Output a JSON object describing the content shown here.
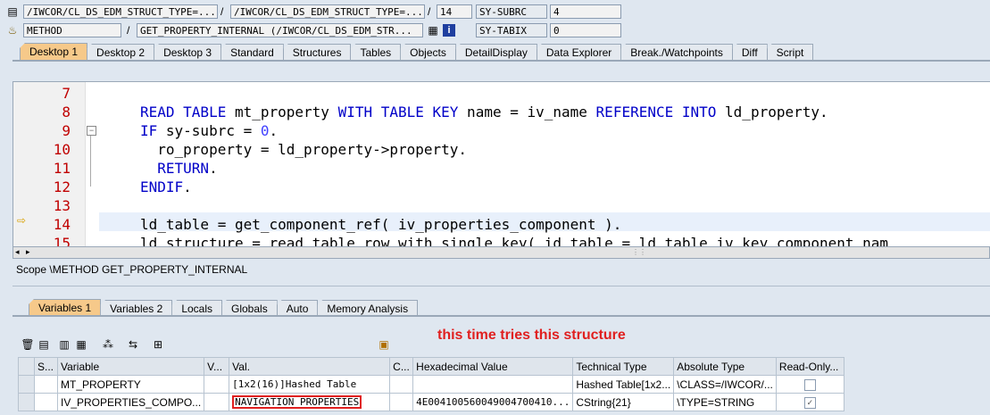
{
  "header": {
    "row1": {
      "f1": "/IWCOR/CL_DS_EDM_STRUCT_TYPE=...",
      "f2": "/IWCOR/CL_DS_EDM_STRUCT_TYPE=...",
      "line": "14",
      "sysname": "SY-SUBRC",
      "sysval": "4"
    },
    "row2": {
      "type": "METHOD",
      "method": "GET_PROPERTY_INTERNAL (/IWCOR/CL_DS_EDM_STR...",
      "sysname": "SY-TABIX",
      "sysval": "0"
    },
    "sep": "/"
  },
  "desktop_tabs": [
    "Desktop 1",
    "Desktop 2",
    "Desktop 3",
    "Standard",
    "Structures",
    "Tables",
    "Objects",
    "DetailDisplay",
    "Data Explorer",
    "Break./Watchpoints",
    "Diff",
    "Script"
  ],
  "editor": {
    "line_numbers": [
      "7",
      "8",
      "9",
      "10",
      "11",
      "12",
      "13",
      "14",
      "15"
    ],
    "lines": {
      "l8a": "READ TABLE",
      "l8b": " mt_property ",
      "l8c": "WITH TABLE KEY",
      "l8d": " name = iv_name ",
      "l8e": "REFERENCE INTO",
      "l8f": " ld_property.",
      "l9a": "IF",
      "l9b": " sy-subrc = ",
      "l9c": "0",
      "l9d": ".",
      "l10": "  ro_property = ld_property->property.",
      "l11a": "  ",
      "l11b": "RETURN",
      "l11c": ".",
      "l12a": "ENDIF",
      "l12b": ".",
      "l14": "ld_table = get_component_ref( iv_properties_component ).",
      "l15": "ld_structure = read_table_row_with_single_key( id_table = ld_table iv_key_component_nam"
    }
  },
  "scope": "Scope \\METHOD GET_PROPERTY_INTERNAL",
  "var_tabs": [
    "Variables 1",
    "Variables 2",
    "Locals",
    "Globals",
    "Auto",
    "Memory Analysis"
  ],
  "annotation": "this time tries this structure",
  "grid": {
    "headers": [
      "S...",
      "Variable",
      "V...",
      "Val.",
      "C...",
      "Hexadecimal Value",
      "Technical Type",
      "Absolute Type",
      "Read-Only..."
    ],
    "rows": [
      {
        "variable": "MT_PROPERTY",
        "value": "[1x2(16)]Hashed Table",
        "hex": "",
        "tech": "Hashed Table[1x2...",
        "abs": "\\CLASS=/IWCOR/...",
        "readonly": false
      },
      {
        "variable": "IV_PROPERTIES_COMPO...",
        "value": "NAVIGATION PROPERTIES",
        "hex": "4E004100560049004700410...",
        "tech": "CString{21}",
        "abs": "\\TYPE=STRING",
        "readonly": true
      }
    ]
  },
  "colors": {
    "annotation": "#e02020",
    "active_tab": "#f6c98a",
    "line_numbers": "#c00000",
    "keyword": "#0000c8"
  }
}
